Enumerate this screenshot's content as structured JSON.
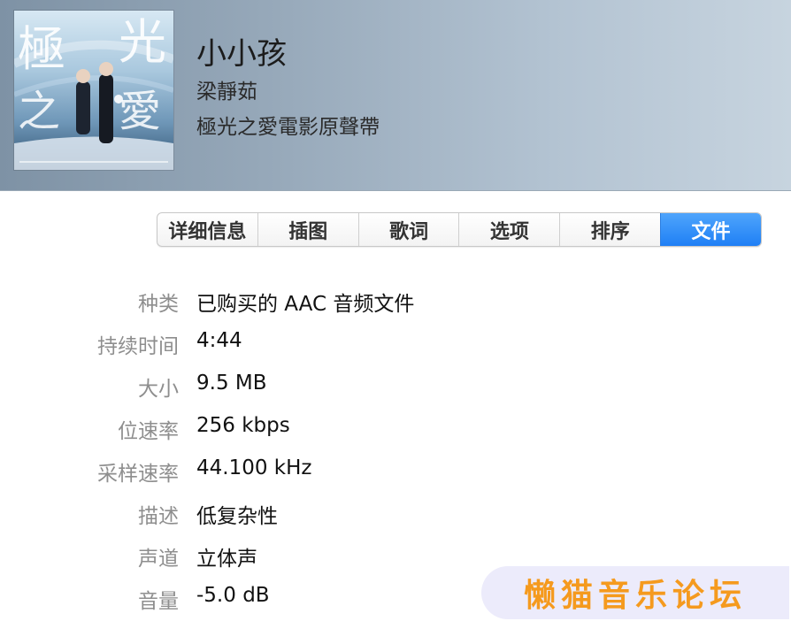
{
  "track": {
    "title": "小小孩",
    "artist": "梁靜茹",
    "album": "極光之愛電影原聲帶"
  },
  "tabs": [
    {
      "label": "详细信息",
      "active": false
    },
    {
      "label": "插图",
      "active": false
    },
    {
      "label": "歌词",
      "active": false
    },
    {
      "label": "选项",
      "active": false
    },
    {
      "label": "排序",
      "active": false
    },
    {
      "label": "文件",
      "active": true
    }
  ],
  "file_info": [
    {
      "label": "种类",
      "value": "已购买的 AAC 音频文件"
    },
    {
      "label": "持续时间",
      "value": "4:44"
    },
    {
      "label": "大小",
      "value": "9.5 MB"
    },
    {
      "label": "位速率",
      "value": "256 kbps"
    },
    {
      "label": "采样速率",
      "value": "44.100 kHz"
    },
    {
      "label": "描述",
      "value": "低复杂性"
    },
    {
      "label": "声道",
      "value": "立体声"
    },
    {
      "label": "音量",
      "value": "-5.0 dB"
    }
  ],
  "watermark": {
    "text": "懒猫音乐论坛"
  },
  "colors": {
    "accent": "#1f7ff5",
    "label_gray": "#8e8e8e",
    "watermark_orange": "#f59a1e"
  },
  "album_art": {
    "title_glyphs": [
      "極",
      "光",
      "之",
      "愛"
    ]
  }
}
